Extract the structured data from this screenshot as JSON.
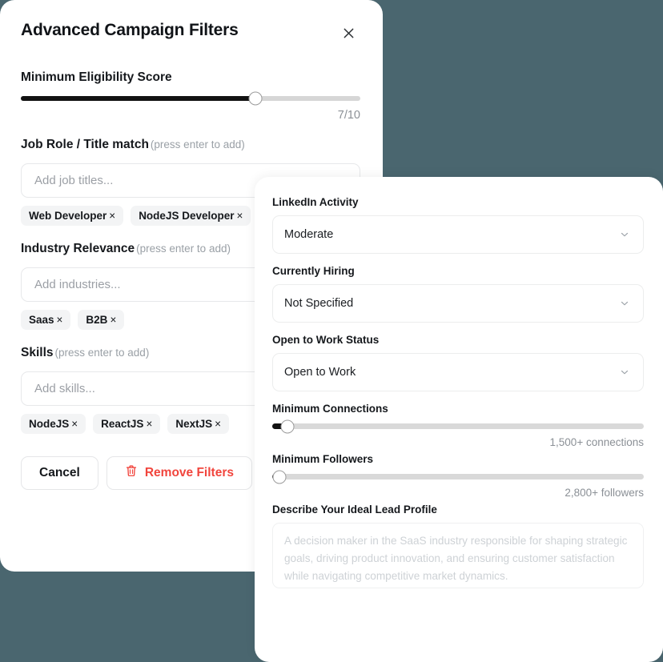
{
  "theme": {
    "background": "#4a666f",
    "accent_danger": "#f1453d",
    "chip_bg": "#f3f4f5"
  },
  "left_panel": {
    "title": "Advanced Campaign Filters",
    "close_icon": "close-icon",
    "eligibility": {
      "label": "Minimum Eligibility Score",
      "value_text": "7/10",
      "percent": 69
    },
    "job_role": {
      "label": "Job Role / Title match",
      "hint": "(press enter to add)",
      "placeholder": "Add job titles...",
      "value": "",
      "chips": [
        "Web Developer",
        "NodeJS Developer"
      ]
    },
    "industry": {
      "label": "Industry Relevance",
      "hint": "(press enter to add)",
      "placeholder": "Add industries...",
      "value": "",
      "chips": [
        "Saas",
        "B2B"
      ]
    },
    "skills": {
      "label": "Skills",
      "hint": "(press enter to add)",
      "placeholder": "Add skills...",
      "value": "",
      "chips": [
        "NodeJS",
        "ReactJS",
        "NextJS"
      ]
    },
    "buttons": {
      "cancel": "Cancel",
      "remove_filters": "Remove Filters",
      "remove_icon": "trash-icon"
    },
    "chip_remove_glyph": "×"
  },
  "right_panel": {
    "linkedin_activity": {
      "label": "LinkedIn Activity",
      "value": "Moderate"
    },
    "currently_hiring": {
      "label": "Currently Hiring",
      "value": "Not Specified"
    },
    "open_to_work": {
      "label": "Open to Work Status",
      "value": "Open to Work"
    },
    "min_connections": {
      "label": "Minimum Connections",
      "value_text": "1,500+ connections",
      "percent": 4
    },
    "min_followers": {
      "label": "Minimum Followers",
      "value_text": "2,800+ followers",
      "percent": 2
    },
    "ideal_lead": {
      "label": "Describe Your Ideal Lead Profile",
      "placeholder": "A decision maker in the SaaS industry responsible for shaping strategic goals, driving product innovation, and ensuring customer satisfaction while navigating competitive market dynamics.",
      "value": ""
    }
  }
}
